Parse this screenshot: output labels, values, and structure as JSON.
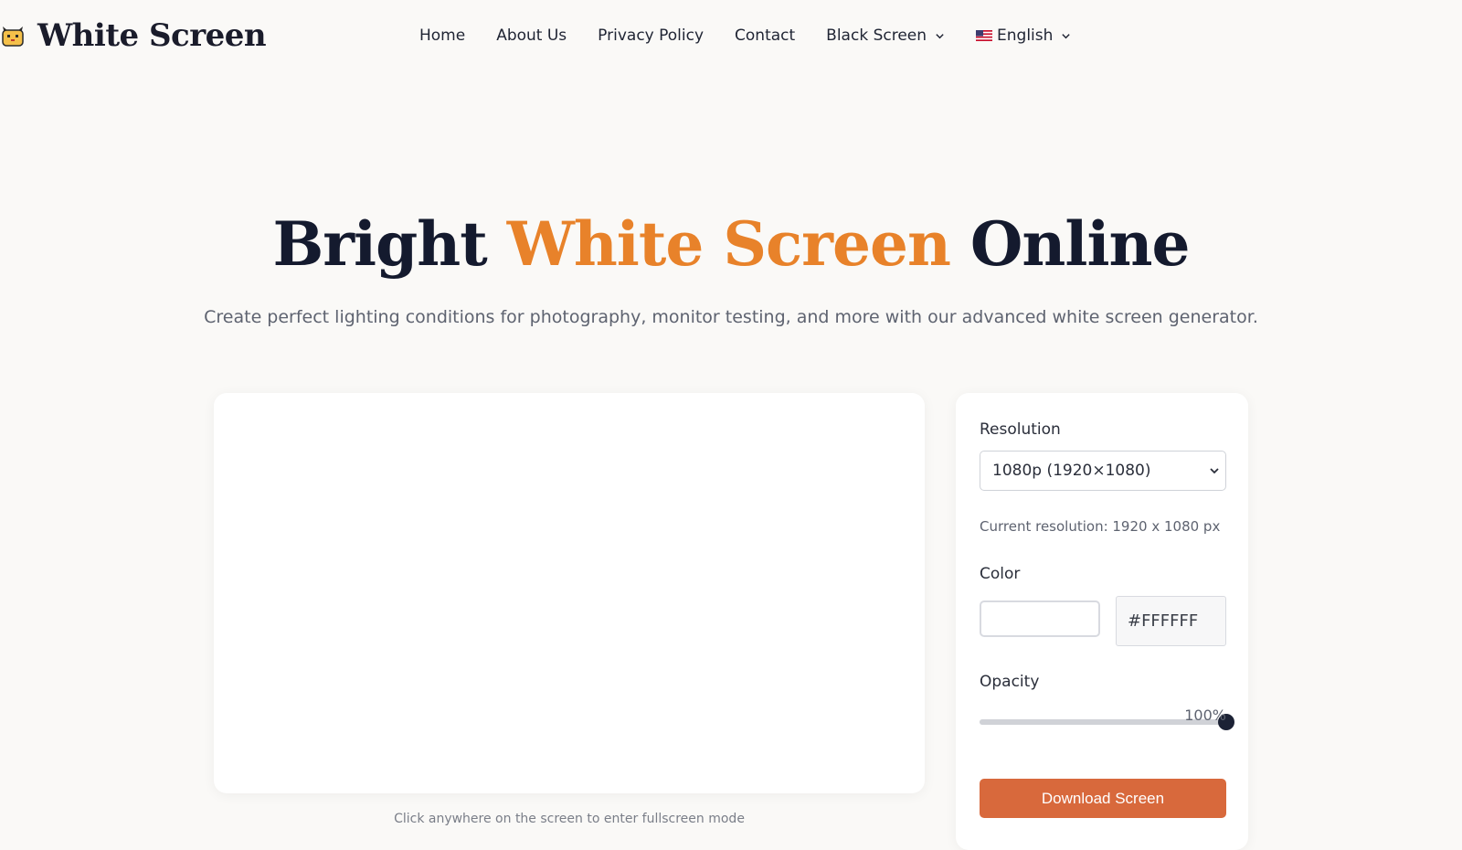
{
  "header": {
    "logo_text": "White Screen",
    "nav": [
      {
        "label": "Home"
      },
      {
        "label": "About Us"
      },
      {
        "label": "Privacy Policy"
      },
      {
        "label": "Contact"
      },
      {
        "label": "Black Screen",
        "dropdown": true
      },
      {
        "label": "English",
        "dropdown": true,
        "icon": "us-flag-icon"
      }
    ]
  },
  "hero": {
    "title_prefix": "Bright",
    "title_accent": "White Screen",
    "title_suffix": "Online",
    "subtitle": "Create perfect lighting conditions for photography, monitor testing, and more with our advanced white screen generator."
  },
  "preview": {
    "background_color": "#FFFFFF",
    "hint": "Click anywhere on the screen to enter fullscreen mode"
  },
  "controls": {
    "resolution_label": "Resolution",
    "resolution_selected": "1080p (1920×1080)",
    "resolution_info": "Current resolution: 1920 x 1080 px",
    "color_label": "Color",
    "color_value": "#FFFFFF",
    "opacity_label": "Opacity",
    "opacity_value": "100%",
    "opacity_level": 1.0,
    "download_label": "Download Screen"
  },
  "colors": {
    "accent": "#e8822a",
    "button": "#d8693c",
    "title": "#141a2e",
    "background": "#faf9f7"
  }
}
